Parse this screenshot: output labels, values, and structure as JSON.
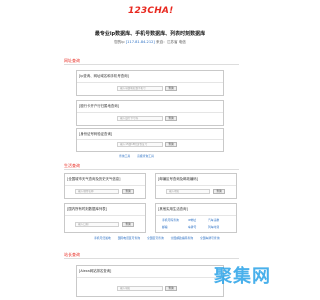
{
  "header": {
    "logo": "123CHA!",
    "tagline": "最专业ip数据库、手机号数据库、列表时刻数据库",
    "ip_prefix": "您的ip",
    "ip_value": "[117.81.84.212]",
    "ip_location": "来自：江苏省 电信"
  },
  "section1": {
    "title": "网址查询",
    "card_ip": {
      "heading": "[ip查询、网址域名和手机号查询]",
      "placeholder": "输入ip或域名或手机号",
      "button": "查询"
    },
    "card_phone": {
      "heading": "[股行卡开户行归属地查询]",
      "placeholder": "输入银行卡号码",
      "button": "查询"
    },
    "card_id": {
      "heading": "[身份证号码验证查询]",
      "placeholder": "输入15或18位身份证号",
      "button": "查询"
    },
    "links": [
      "查询工具",
      "高级查询工具"
    ]
  },
  "section2": {
    "title": "生活查询",
    "card_weather": {
      "heading": "[全国城市天气查询及历史天气信息]",
      "placeholder": "输入城市名称",
      "button": "查询"
    },
    "card_post": {
      "heading": "[邮编区号查询及邮政编码]",
      "placeholder": "输入地名",
      "button": "查询"
    },
    "card_date": {
      "heading": "[国内所有时刻数据库列表]",
      "placeholder": "输入日期",
      "button": "查询"
    },
    "card_other": {
      "heading": "[其他实用生活查询]"
    },
    "other_links": [
      "手机号码查询",
      "IP地址",
      "汽车违章",
      "邮编",
      "车牌号",
      "列车时刻"
    ],
    "links": [
      "手机号归属地",
      "国际电话区号查询",
      "全国区号查询",
      "全国邮政编码查询",
      "全国车牌号查询"
    ]
  },
  "section3": {
    "title": "站长查询",
    "card_alexa": {
      "heading": "[Alexa网站排名查询]",
      "placeholder": "输入域名",
      "button": "查询"
    }
  },
  "watermark": "聚集网"
}
